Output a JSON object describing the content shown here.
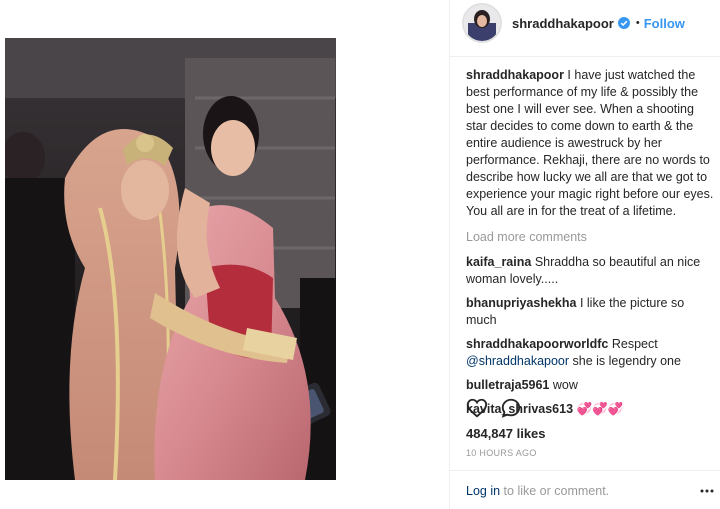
{
  "post": {
    "username": "shraddhakapoor",
    "separator": "•",
    "follow_label": "Follow",
    "caption_username": "shraddhakapoor",
    "caption_text": "I have just watched the best performance of my life & possibly the best one I will ever see. When a shooting star decides to come down to earth & the entire audience is awestruck by her performance. Rekhaji, there are no words to describe how lucky we all are that we got to experience your magic right before our eyes. You all are in for the treat of a lifetime.",
    "load_more_label": "Load more comments",
    "comments": [
      {
        "username": "kaifa_raina",
        "text": "Shraddha so beautiful an nice woman lovely....."
      },
      {
        "username": "bhanupriyashekha",
        "text": "I like the picture so much"
      },
      {
        "username": "shraddhakapoorworldfc",
        "text": "Respect",
        "mention": "@shraddhakapoor",
        "text_after": "she is legendry one"
      },
      {
        "username": "bulletraja5961",
        "text": "wow"
      },
      {
        "username": "kavita_shrivas613",
        "text": "💞💞💞"
      }
    ],
    "likes": "484,847 likes",
    "timestamp": "10 HOURS AGO",
    "login_link": "Log in",
    "login_suffix": "to like or comment."
  },
  "icons": {
    "verified": "verified-badge-icon",
    "like": "heart-outline-icon",
    "comment": "speech-bubble-icon",
    "more": "more-dots-icon"
  },
  "colors": {
    "link_blue": "#3897f0",
    "dark_link": "#003569",
    "muted": "#999999",
    "text": "#262626"
  }
}
